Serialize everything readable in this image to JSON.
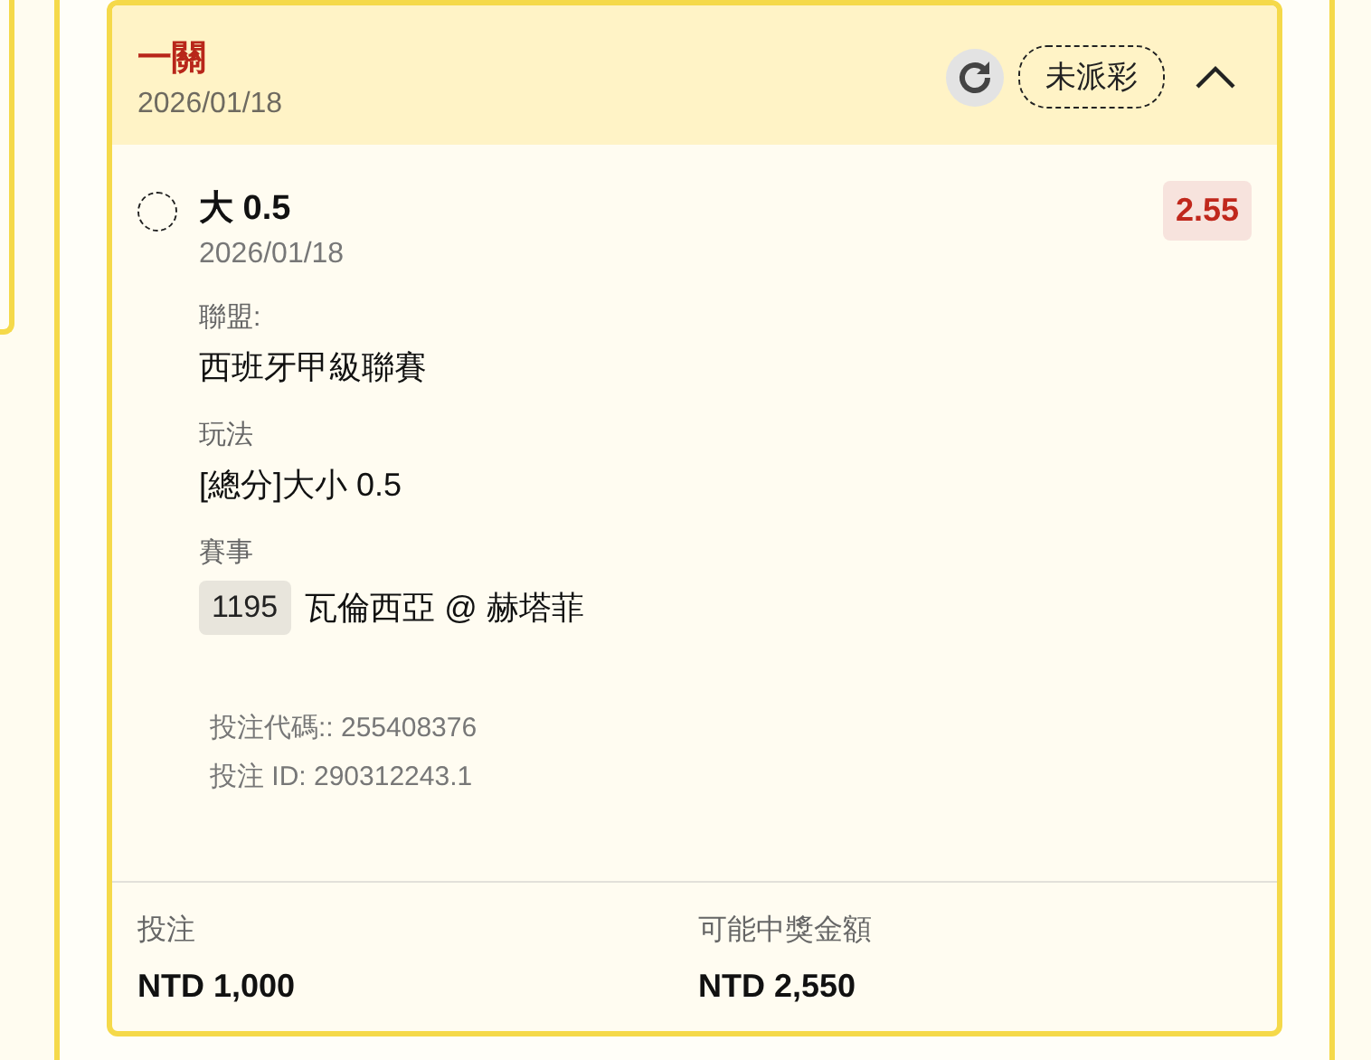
{
  "bet": {
    "title": "一關",
    "date": "2026/01/18",
    "status": "未派彩",
    "expanded": true,
    "selections": [
      {
        "name": "大 0.5",
        "date": "2026/01/18",
        "odds": "2.55",
        "fields": [
          {
            "label": "聯盟:",
            "value": "西班牙甲級聯賽"
          },
          {
            "label": "玩法",
            "value": "[總分]大小 0.5"
          }
        ],
        "event": {
          "label": "賽事",
          "id": "1195",
          "match": "瓦倫西亞 @ 赫塔菲"
        }
      }
    ],
    "codes": [
      "投注代碼:: 255408376",
      "投注 ID: 290312243.1"
    ],
    "summary": [
      {
        "label": "投注",
        "value": "NTD 1,000"
      },
      {
        "label": "可能中獎金額",
        "value": "NTD 2,550"
      }
    ]
  }
}
